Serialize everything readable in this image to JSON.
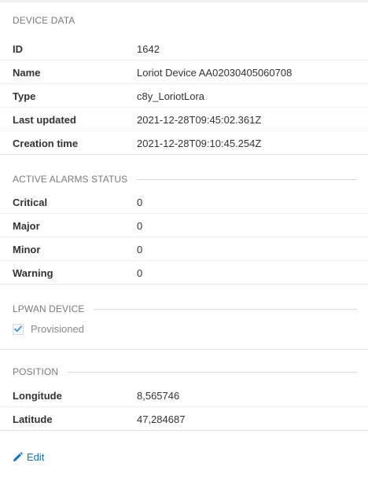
{
  "device_data": {
    "title": "DEVICE DATA",
    "rows": [
      {
        "key": "ID",
        "value": "1642"
      },
      {
        "key": "Name",
        "value": "Loriot Device AA02030405060708"
      },
      {
        "key": "Type",
        "value": "c8y_LoriotLora"
      },
      {
        "key": "Last updated",
        "value": "2021-12-28T09:45:02.361Z"
      },
      {
        "key": "Creation time",
        "value": "2021-12-28T09:10:45.254Z"
      }
    ]
  },
  "alarms": {
    "title": "ACTIVE ALARMS STATUS",
    "rows": [
      {
        "key": "Critical",
        "value": "0"
      },
      {
        "key": "Major",
        "value": "0"
      },
      {
        "key": "Minor",
        "value": "0"
      },
      {
        "key": "Warning",
        "value": "0"
      }
    ]
  },
  "lpwan": {
    "title": "LPWAN DEVICE",
    "provisioned_label": "Provisioned",
    "provisioned_checked": true
  },
  "position": {
    "title": "POSITION",
    "rows": [
      {
        "key": "Longitude",
        "value": "8,565746"
      },
      {
        "key": "Latitude",
        "value": "47,284687"
      }
    ]
  },
  "actions": {
    "edit_label": "Edit",
    "edit_icon": "pencil-icon"
  },
  "colors": {
    "accent": "#1776bf",
    "check": "#4a8fd6",
    "muted_text": "#7a7a7a"
  }
}
